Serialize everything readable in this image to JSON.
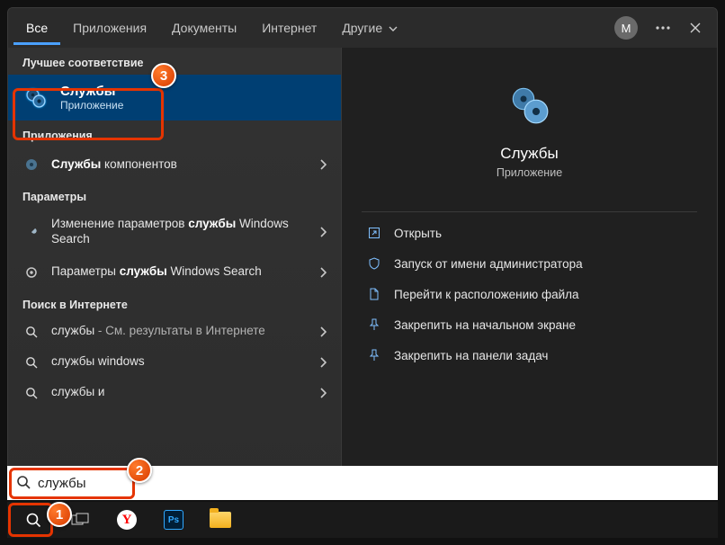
{
  "tabs": {
    "all": "Все",
    "apps": "Приложения",
    "docs": "Документы",
    "internet": "Интернет",
    "more": "Другие"
  },
  "avatar": "M",
  "sections": {
    "best": "Лучшее соответствие",
    "apps": "Приложения",
    "settings": "Параметры",
    "web": "Поиск в Интернете"
  },
  "best_match": {
    "title": "Службы",
    "subtitle": "Приложение"
  },
  "apps_list": {
    "item0_prefix": "Службы",
    "item0_rest": " компонентов"
  },
  "settings_list": {
    "item0_a": "Изменение параметров ",
    "item0_b": "службы",
    "item0_c": " Windows Search",
    "item1_a": "Параметры ",
    "item1_b": "службы",
    "item1_c": " Windows Search"
  },
  "web_list": {
    "q0": "службы",
    "q0_suffix": " - См. результаты в Интернете",
    "q1": "службы windows",
    "q2": "службы и"
  },
  "detail": {
    "title": "Службы",
    "subtitle": "Приложение"
  },
  "actions": {
    "open": "Открыть",
    "run_admin": "Запуск от имени администратора",
    "open_location": "Перейти к расположению файла",
    "pin_start": "Закрепить на начальном экране",
    "pin_taskbar": "Закрепить на панели задач"
  },
  "search": {
    "value": "службы"
  },
  "annotations": {
    "b1": "1",
    "b2": "2",
    "b3": "3"
  }
}
